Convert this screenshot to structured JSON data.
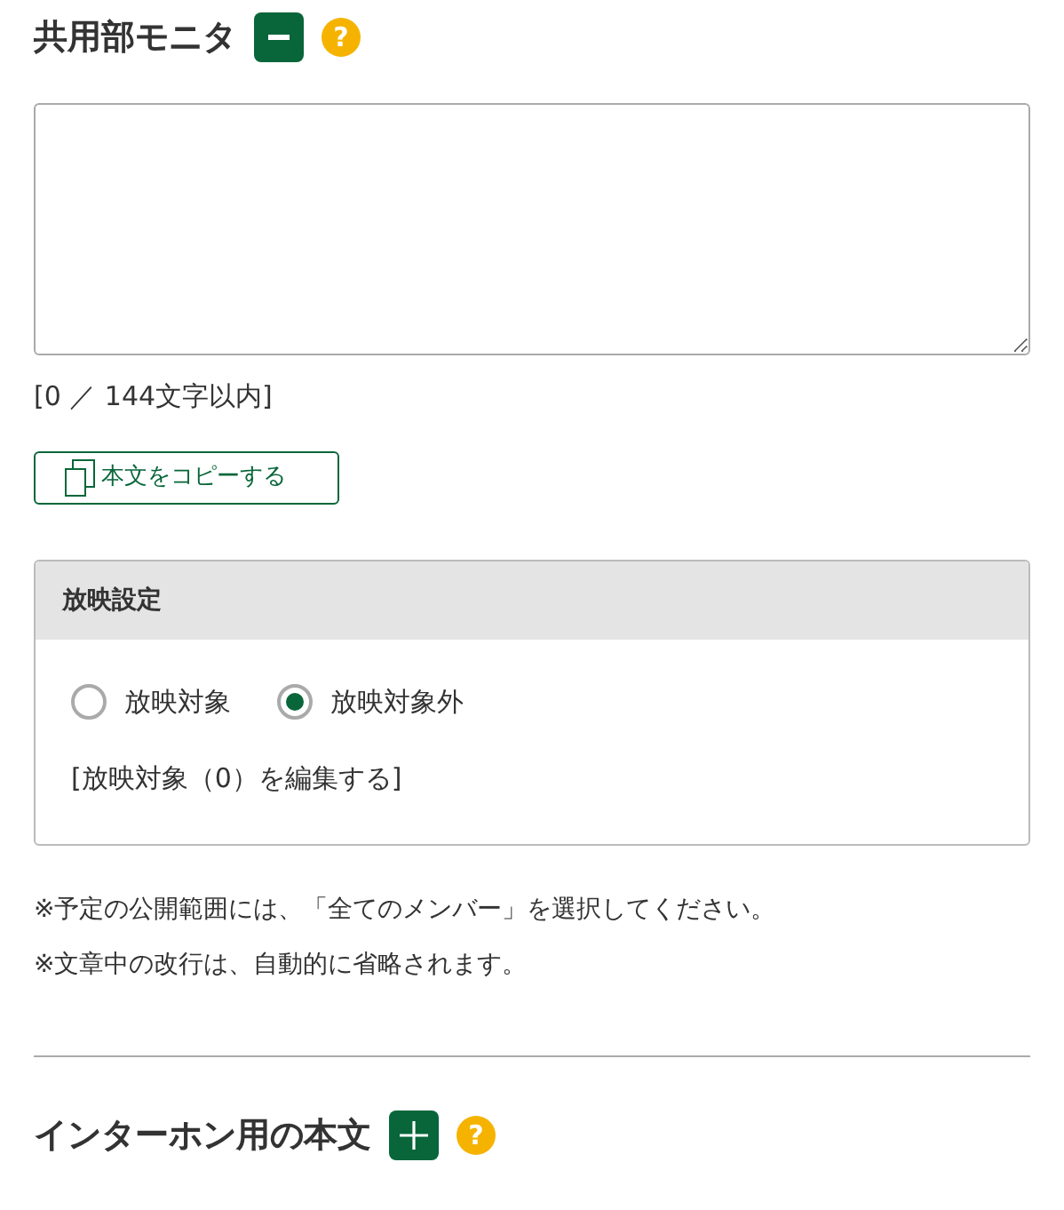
{
  "sections": [
    {
      "title": "共用部モニタ",
      "expanded": true,
      "help": "?",
      "counter": "[0 ／ 144文字以内]",
      "copy_button": "本文をコピーする",
      "panel": {
        "title": "放映設定",
        "options": [
          {
            "label": "放映対象",
            "selected": false
          },
          {
            "label": "放映対象外",
            "selected": true
          }
        ],
        "edit_link": "[放映対象（0）を編集する]"
      },
      "notes": [
        "※予定の公開範囲には、「全てのメンバー」を選択してください。",
        "※文章中の改行は、自動的に省略されます。"
      ]
    },
    {
      "title": "インターホン用の本文",
      "expanded": false,
      "help": "?"
    }
  ]
}
